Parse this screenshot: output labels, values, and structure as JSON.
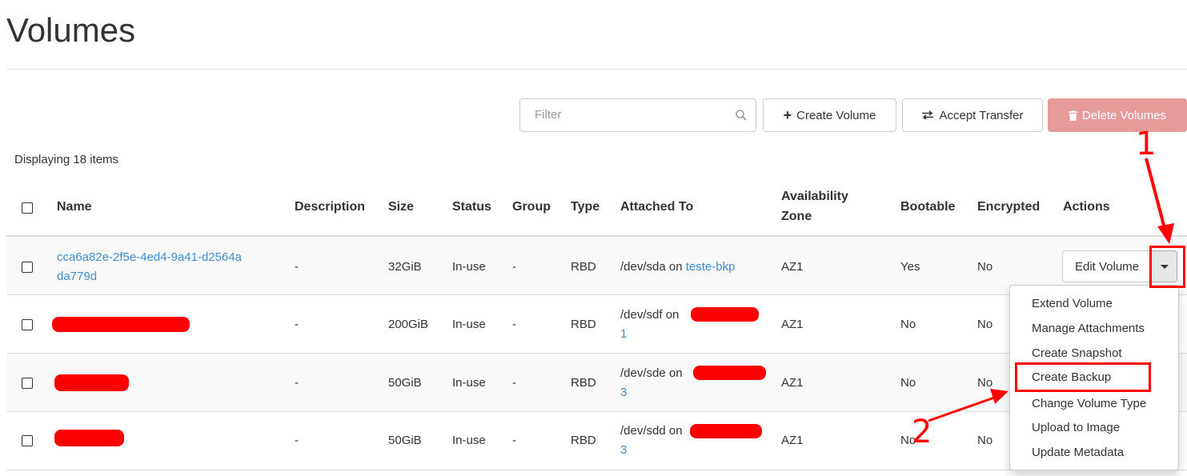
{
  "page": {
    "title": "Volumes"
  },
  "toolbar": {
    "filter_placeholder": "Filter",
    "search_icon": "search-icon",
    "create_volume": "Create Volume",
    "accept_transfer": "Accept Transfer",
    "delete_volumes": "Delete Volumes",
    "delete_color": "#e79a9a"
  },
  "table": {
    "count_text": "Displaying 18 items",
    "headers": {
      "name": "Name",
      "description": "Description",
      "size": "Size",
      "status": "Status",
      "group": "Group",
      "type": "Type",
      "attached_to": "Attached To",
      "availability_zone_line1": "Availability",
      "availability_zone_line2": "Zone",
      "bootable": "Bootable",
      "encrypted": "Encrypted",
      "actions": "Actions"
    },
    "rows": [
      {
        "name_line1": "cca6a82e-2f5e-4ed4-9a41-d2564a",
        "name_line2": "da779d",
        "description": "-",
        "size": "32GiB",
        "status": "In-use",
        "group": "-",
        "type": "RBD",
        "attached_prefix": "/dev/sda on",
        "attached_link": "teste-bkp",
        "zone": "AZ1",
        "bootable": "Yes",
        "encrypted": "No"
      },
      {
        "name_line1": "",
        "description": "-",
        "size": "200GiB",
        "status": "In-use",
        "group": "-",
        "type": "RBD",
        "attached_prefix": "/dev/sdf on",
        "attached_link": "1",
        "zone": "AZ1",
        "bootable": "No",
        "encrypted": "No"
      },
      {
        "name_line1": "",
        "description": "-",
        "size": "50GiB",
        "status": "In-use",
        "group": "-",
        "type": "RBD",
        "attached_prefix": "/dev/sde on",
        "attached_link": "3",
        "zone": "AZ1",
        "bootable": "No",
        "encrypted": "No"
      },
      {
        "name_line1": "",
        "description": "-",
        "size": "50GiB",
        "status": "In-use",
        "group": "-",
        "type": "RBD",
        "attached_prefix": "/dev/sdd on",
        "attached_link": "3",
        "zone": "AZ1",
        "bootable": "No",
        "encrypted": "No"
      }
    ]
  },
  "actions": {
    "edit_volume": "Edit Volume",
    "menu": [
      "Extend Volume",
      "Manage Attachments",
      "Create Snapshot",
      "Create Backup",
      "Change Volume Type",
      "Upload to Image",
      "Update Metadata"
    ]
  },
  "annotations": {
    "label1": "1",
    "label2": "2",
    "color": "#ff0000"
  }
}
